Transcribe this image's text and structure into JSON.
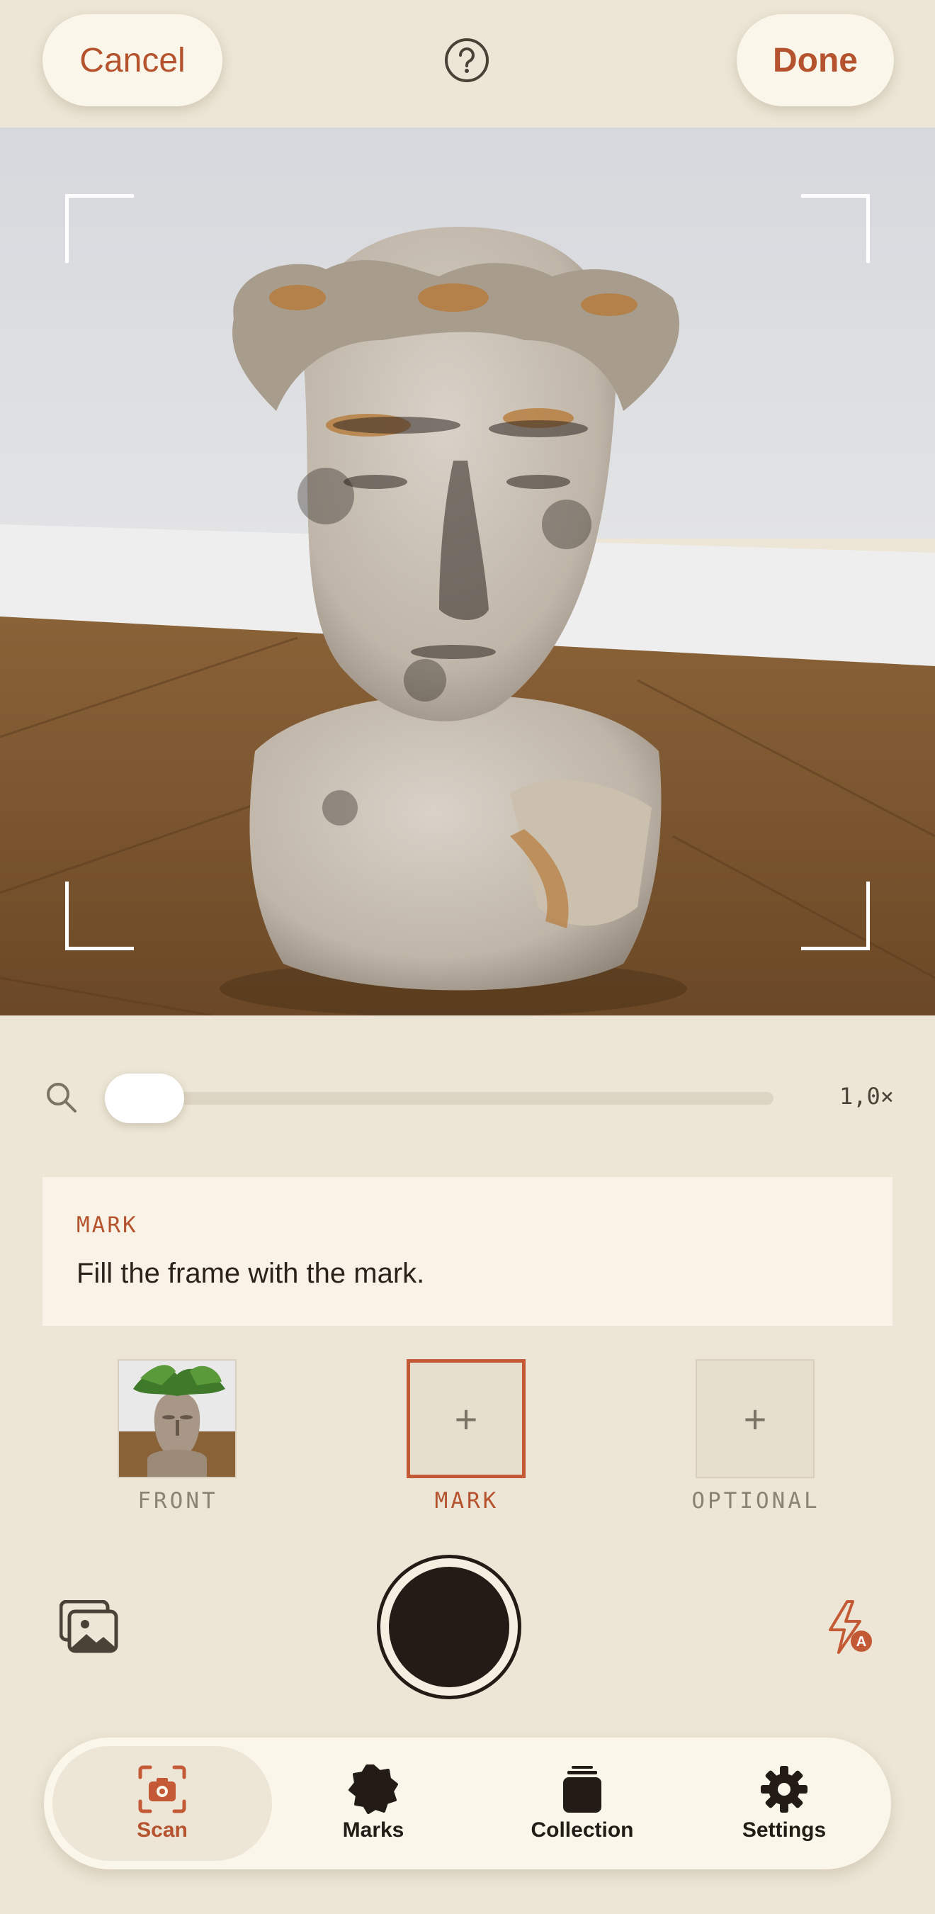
{
  "header": {
    "cancel_label": "Cancel",
    "done_label": "Done",
    "help_icon": "question-circle-icon"
  },
  "zoom": {
    "value_label": "1,0×",
    "level_fraction": 0.0
  },
  "hint": {
    "title": "MARK",
    "text": "Fill the frame with the mark."
  },
  "slots": [
    {
      "label": "FRONT",
      "state": "captured"
    },
    {
      "label": "MARK",
      "state": "active",
      "glyph": "+"
    },
    {
      "label": "OPTIONAL",
      "state": "empty",
      "glyph": "+"
    }
  ],
  "tabs": [
    {
      "label": "Scan",
      "icon": "camera-scan-icon",
      "active": true
    },
    {
      "label": "Marks",
      "icon": "badge-icon",
      "active": false
    },
    {
      "label": "Collection",
      "icon": "stack-icon",
      "active": false
    },
    {
      "label": "Settings",
      "icon": "gear-icon",
      "active": false
    }
  ],
  "colors": {
    "accent": "#b5532e",
    "background": "#ede6d6",
    "card": "#f8f3e6",
    "dark": "#231c16"
  }
}
